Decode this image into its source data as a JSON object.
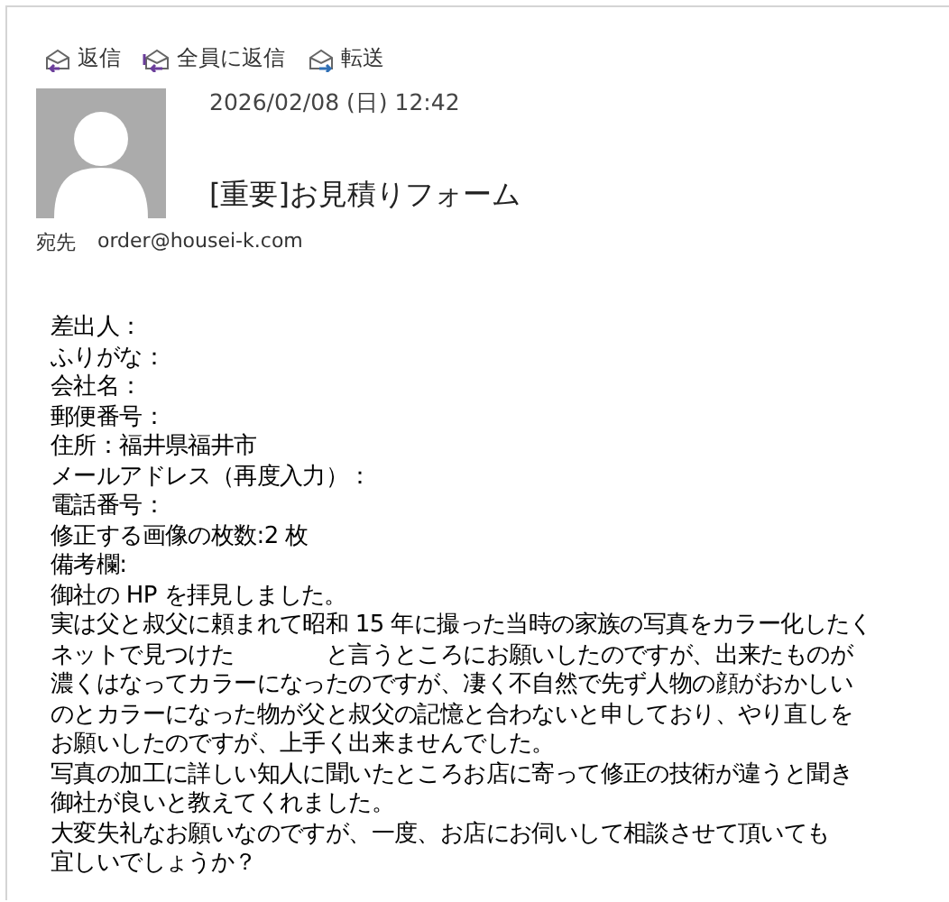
{
  "toolbar": [
    {
      "kind": "reply",
      "label": "返信"
    },
    {
      "kind": "reply_all",
      "label": "全員に返信"
    },
    {
      "kind": "forward",
      "label": "転送"
    }
  ],
  "message": {
    "date": "2026/02/08 (日) 12:42",
    "subject": "[重要]お見積りフォーム",
    "to_label": "宛先",
    "to": "order@housei-k.com"
  },
  "body_lines": [
    "差出人：",
    "ふりがな：",
    "会社名：",
    "郵便番号：",
    "住所：福井県福井市",
    "メールアドレス（再度入力）：",
    "電話番号：",
    "修正する画像の枚数:2 枚",
    "備考欄:",
    "御社の HP を拝見しました。",
    "実は父と叔父に頼まれて昭和 15 年に撮った当時の家族の写真をカラー化したく",
    "ネットで見つけた　　　　と言うところにお願いしたのですが、出来たものが",
    "濃くはなってカラーになったのですが、凄く不自然で先ず人物の顔がおかしい",
    "のとカラーになった物が父と叔父の記憶と合わないと申しており、やり直しを",
    "お願いしたのですが、上手く出来ませんでした。",
    "写真の加工に詳しい知人に聞いたところお店に寄って修正の技術が違うと聞き",
    "御社が良いと教えてくれました。",
    "大変失礼なお願いなのですが、一度、お店にお伺いして相談させて頂いても",
    "宜しいでしょうか？"
  ]
}
